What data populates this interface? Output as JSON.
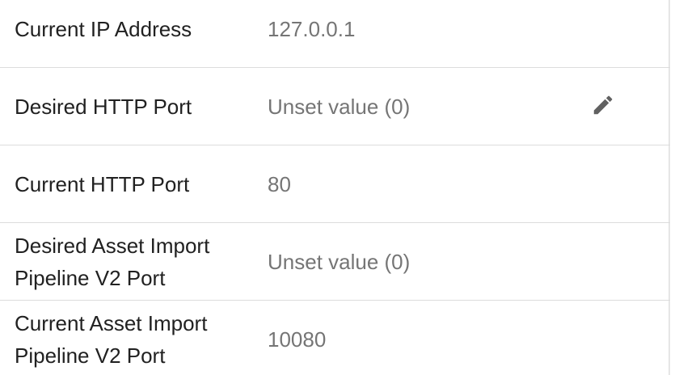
{
  "settings": [
    {
      "label": "Current IP Address",
      "value": "127.0.0.1",
      "editable": false
    },
    {
      "label": "Desired HTTP Port",
      "value": "Unset value (0)",
      "editable": true,
      "edit_icon": "pencil-icon"
    },
    {
      "label": "Current HTTP Port",
      "value": "80",
      "editable": false
    },
    {
      "label": "Desired Asset Import Pipeline V2 Port",
      "value": "Unset value (0)",
      "editable": false
    },
    {
      "label": "Current Asset Import Pipeline V2 Port",
      "value": "10080",
      "editable": false
    }
  ],
  "colors": {
    "label": "#212121",
    "value": "#757575",
    "icon": "#616161",
    "divider": "#dcdcdc"
  }
}
